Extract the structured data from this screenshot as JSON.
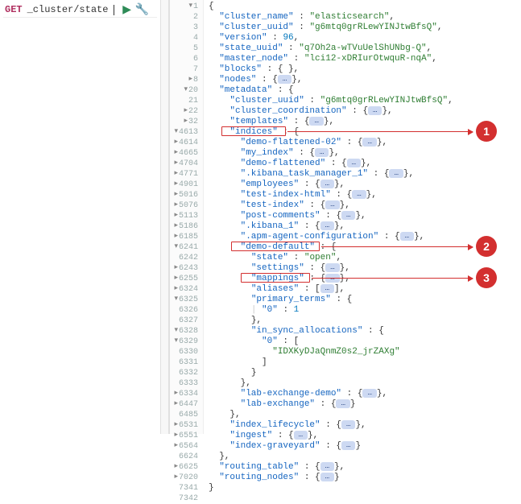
{
  "request": {
    "method": "GET",
    "path": "_cluster/state"
  },
  "icons": {
    "run": "▶",
    "wrench": "🔧"
  },
  "gutter": [
    "1",
    "2",
    "3",
    "4",
    "5",
    "6",
    "7",
    "8",
    "20",
    "21",
    "22",
    "32",
    "4613",
    "4614",
    "4665",
    "4704",
    "4771",
    "4901",
    "5016",
    "5076",
    "5113",
    "5186",
    "6185",
    "6241",
    "6242",
    "6243",
    "6255",
    "6324",
    "6325",
    "6326",
    "6327",
    "6328",
    "6329",
    "6330",
    "6331",
    "6332",
    "6333",
    "6334",
    "6447",
    "6485",
    "6531",
    "6551",
    "6564",
    "6624",
    "6625",
    "7020",
    "7341",
    "7342"
  ],
  "lines": {
    "l0": "{",
    "l1_k": "\"cluster_name\"",
    "l1_v": "\"elasticsearch\"",
    "l2_k": "\"cluster_uuid\"",
    "l2_v": "\"g6mtq0grRLewYINJtwBfsQ\"",
    "l3_k": "\"version\"",
    "l3_v": "96",
    "l4_k": "\"state_uuid\"",
    "l4_v": "\"q7Oh2a-wTVuUelShUNbg-Q\"",
    "l5_k": "\"master_node\"",
    "l5_v": "\"lci12-xDRIurOtwquR-nqA\"",
    "l6_k": "\"blocks\"",
    "l7_k": "\"nodes\"",
    "l8_k": "\"metadata\"",
    "l9_k": "\"cluster_uuid\"",
    "l9_v": "\"g6mtq0grRLewYINJtwBfsQ\"",
    "l10_k": "\"cluster_coordination\"",
    "l11_k": "\"templates\"",
    "l12_k": "\"indices\"",
    "l13_k": "\"demo-flattened-02\"",
    "l14_k": "\"my_index\"",
    "l15_k": "\"demo-flattened\"",
    "l16_k": "\".kibana_task_manager_1\"",
    "l17_k": "\"employees\"",
    "l18_k": "\"test-index-html\"",
    "l19_k": "\"test-index\"",
    "l20_k": "\"post-comments\"",
    "l21_k": "\".kibana_1\"",
    "l22_k": "\".apm-agent-configuration\"",
    "l23_k": "\"demo-default\"",
    "l24_k": "\"state\"",
    "l24_v": "\"open\"",
    "l25_k": "\"settings\"",
    "l26_k": "\"mappings\"",
    "l27_k": "\"aliases\"",
    "l28_k": "\"primary_terms\"",
    "l29_k": "\"0\"",
    "l29_v": "1",
    "l30": "},",
    "l31_k": "\"in_sync_allocations\"",
    "l32_k": "\"0\"",
    "l33_v": "\"IDXKyDJaQnmZ0s2_jrZAXg\"",
    "l34": "]",
    "l35": "}",
    "l36": "},",
    "l37_k": "\"lab-exchange-demo\"",
    "l38_k": "\"lab-exchange\"",
    "l39": "},",
    "l40_k": "\"index_lifecycle\"",
    "l41_k": "\"ingest\"",
    "l42_k": "\"index-graveyard\"",
    "l43": "},",
    "l44_k": "\"routing_table\"",
    "l45_k": "\"routing_nodes\"",
    "l46": "}",
    "l47": ""
  },
  "badge": "…",
  "callouts": {
    "c1": "1",
    "c2": "2",
    "c3": "3"
  }
}
